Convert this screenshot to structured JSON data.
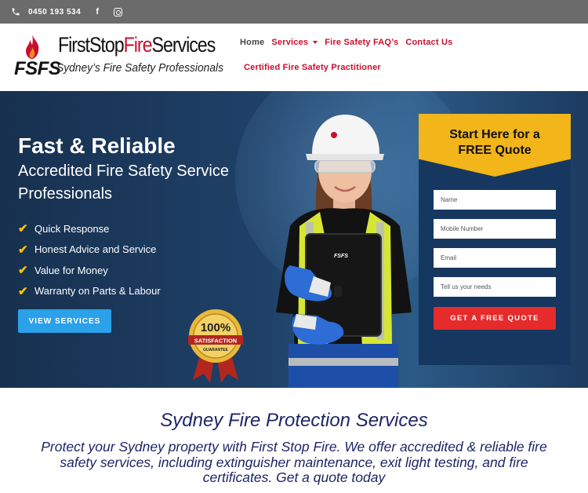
{
  "topbar": {
    "phone": "0450 193 534",
    "icons": [
      "phone-icon",
      "facebook-icon",
      "instagram-icon"
    ]
  },
  "logo": {
    "mark": "FSFS",
    "brand_part1": "FirstStop",
    "brand_part2": "Fire",
    "brand_part3": "Services",
    "tagline": "Sydney’s Fire  Safety Professionals"
  },
  "nav": {
    "home": "Home",
    "services": "Services",
    "faq": "Fire Safety FAQ’s",
    "contact": "Contact Us",
    "practitioner": "Certified Fire Safety Practitioner"
  },
  "hero": {
    "title": "Fast & Reliable",
    "subtitle": "Accredited Fire Safety Service Professionals",
    "bullets": [
      "Quick Response",
      "Honest Advice and Service",
      "Value for Money",
      "Warranty on Parts & Labour"
    ],
    "cta": "VIEW SERVICES",
    "badge_top": "100%",
    "badge_mid": "SATISFACTION",
    "badge_bottom": "GUARANTEE",
    "clipboard_logo": "FSFS"
  },
  "quote": {
    "heading": "Start Here for a FREE Quote",
    "name_placeholder": "Name",
    "mobile_placeholder": "Mobile Number",
    "email_placeholder": "Email",
    "needs_placeholder": "Tell us your needs",
    "submit": "GET A FREE QUOTE"
  },
  "section": {
    "title": "Sydney Fire Protection Services",
    "body": "Protect your Sydney property with First Stop Fire. We offer accredited & reliable fire safety services, including extinguisher maintenance, exit light testing, and fire certificates. Get a quote today"
  },
  "colors": {
    "brand_red": "#c8102e",
    "hero_navy": "#1f4168",
    "quote_yellow": "#f2b51a",
    "cta_blue": "#2aa1e8",
    "submit_red": "#e52b2b",
    "text_navy": "#1d2566"
  }
}
